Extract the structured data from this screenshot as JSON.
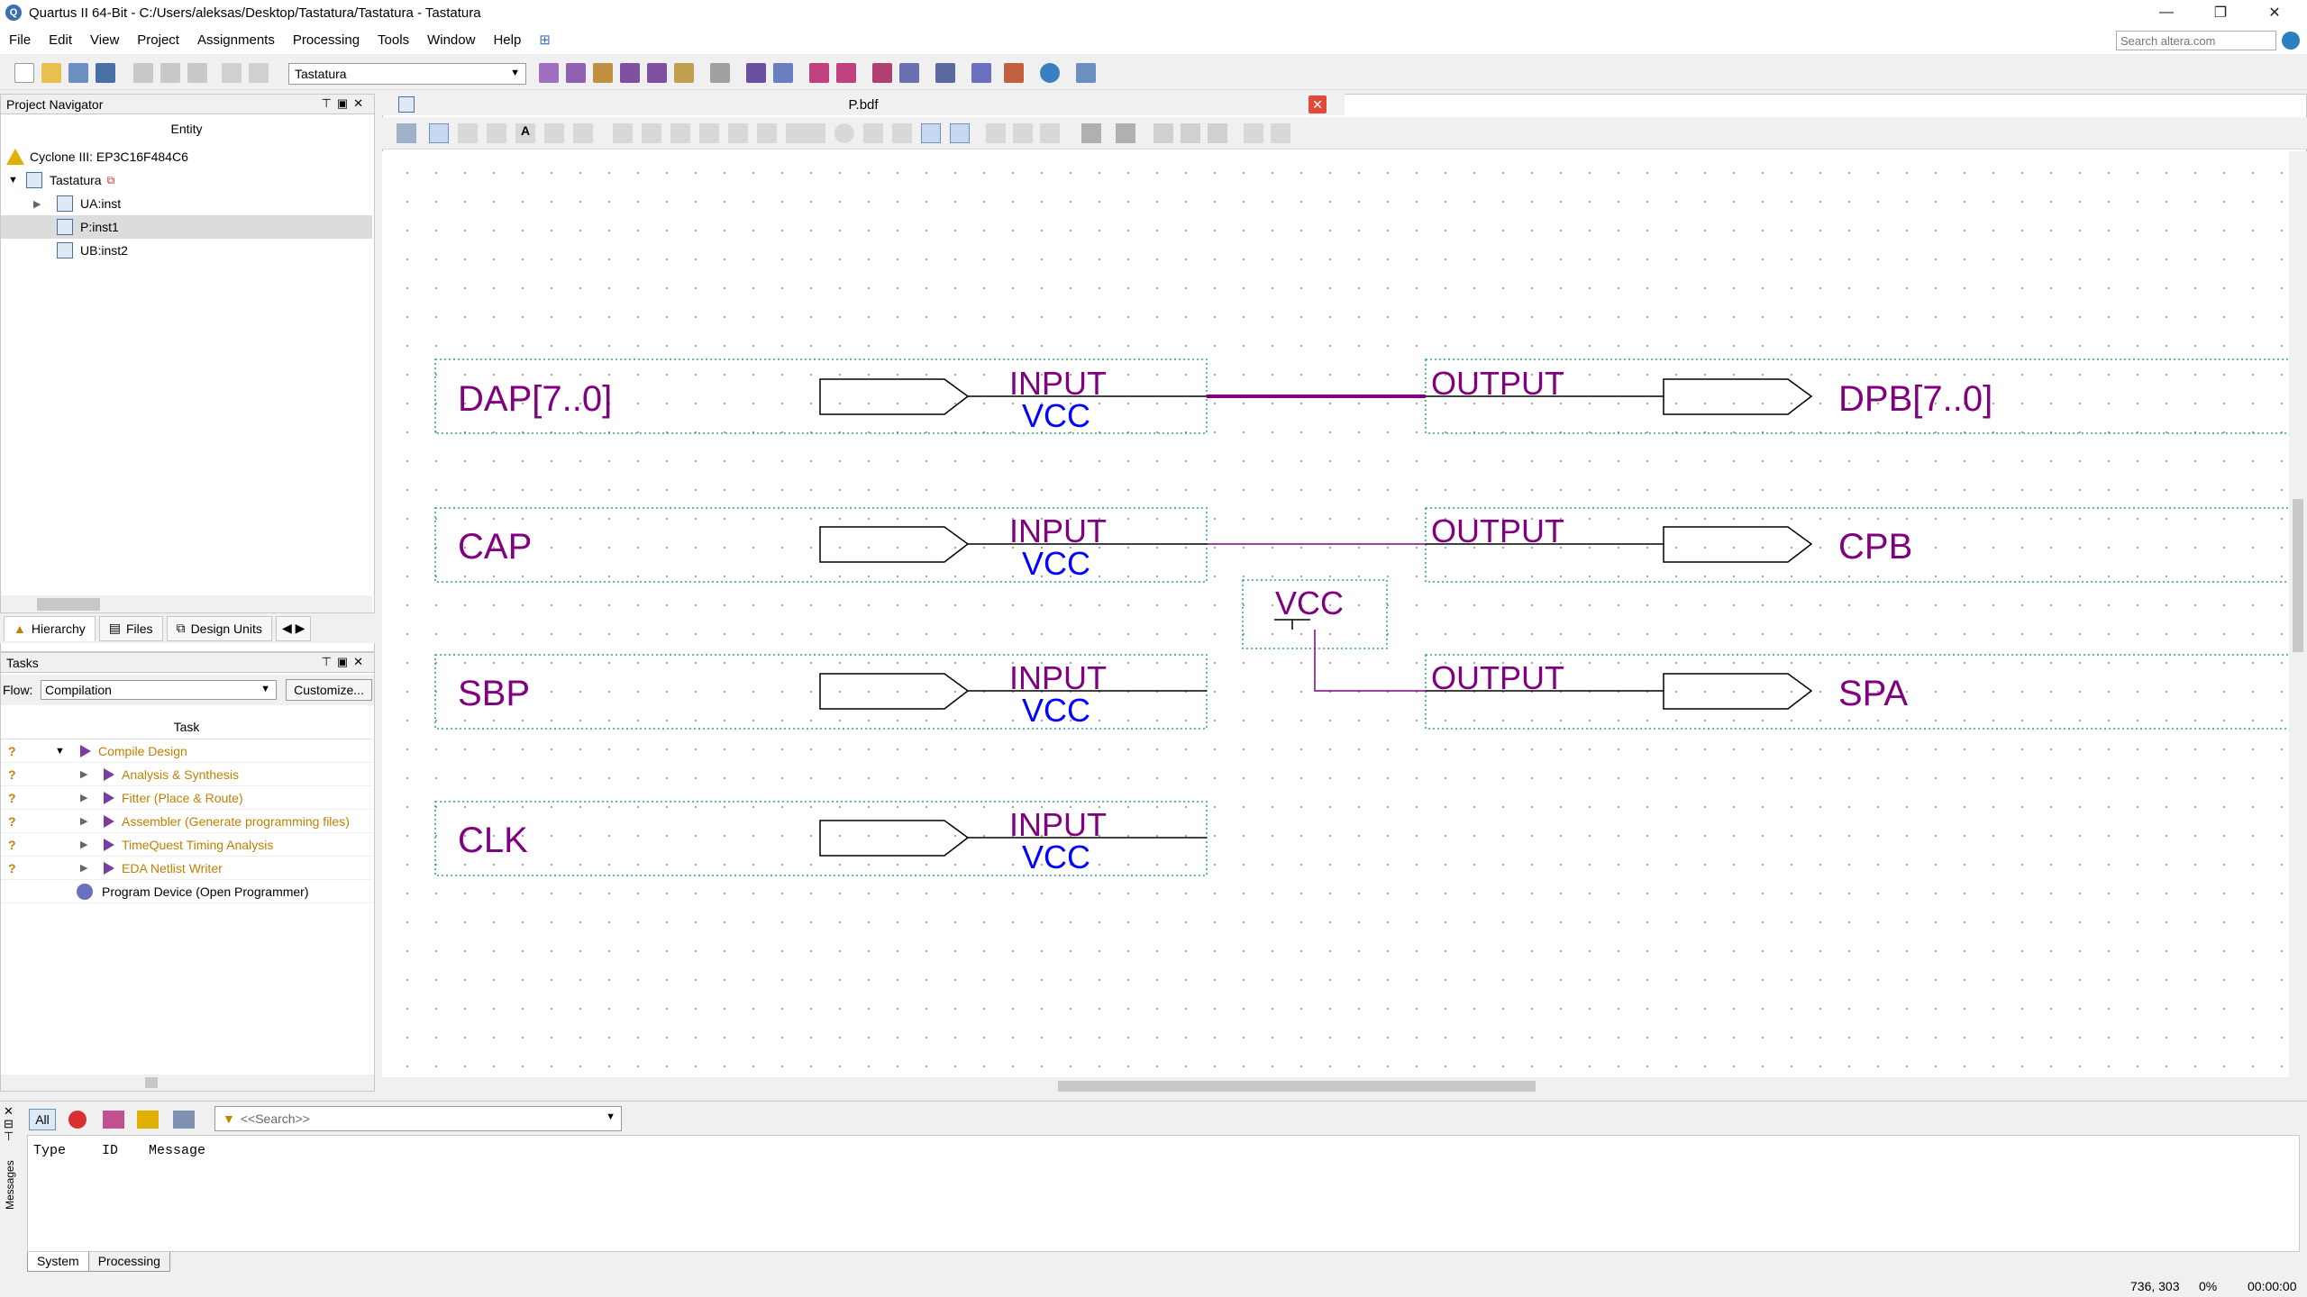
{
  "window": {
    "title": "Quartus II 64-Bit - C:/Users/aleksas/Desktop/Tastatura/Tastatura - Tastatura",
    "minimize": "—",
    "maximize": "❐",
    "close": "✕"
  },
  "menu": [
    "File",
    "Edit",
    "View",
    "Project",
    "Assignments",
    "Processing",
    "Tools",
    "Window",
    "Help"
  ],
  "search": {
    "placeholder": "Search altera.com"
  },
  "toolbar": {
    "project_select": "Tastatura"
  },
  "navigator": {
    "title": "Project Navigator",
    "column": "Entity",
    "device": "Cyclone III: EP3C16F484C6",
    "root": "Tastatura",
    "items": [
      {
        "label": "UA:inst",
        "selected": false
      },
      {
        "label": "P:inst1",
        "selected": true
      },
      {
        "label": "UB:inst2",
        "selected": false
      }
    ],
    "tabs": [
      "Hierarchy",
      "Files",
      "Design Units"
    ]
  },
  "tasks": {
    "title": "Tasks",
    "flow_label": "Flow:",
    "flow_value": "Compilation",
    "customize": "Customize...",
    "column": "Task",
    "items": [
      {
        "label": "Compile Design",
        "status": "?"
      },
      {
        "label": "Analysis & Synthesis",
        "status": "?"
      },
      {
        "label": "Fitter (Place & Route)",
        "status": "?"
      },
      {
        "label": "Assembler (Generate programming files)",
        "status": "?"
      },
      {
        "label": "TimeQuest Timing Analysis",
        "status": "?"
      },
      {
        "label": "EDA Netlist Writer",
        "status": "?"
      },
      {
        "label": "Program Device (Open Programmer)",
        "status": ""
      }
    ]
  },
  "document": {
    "tab": "P.bdf"
  },
  "schematic": {
    "pin_type_input": "INPUT",
    "pin_type_output": "OUTPUT",
    "pin_default": "VCC",
    "vcc_symbol": "VCC",
    "inputs": [
      "DAP[7..0]",
      "CAP",
      "SBP",
      "CLK"
    ],
    "outputs": [
      "DPB[7..0]",
      "CPB",
      "SPA"
    ],
    "colors": {
      "pin_name": "#800080",
      "default": "#0000ff",
      "wire": "#800080"
    }
  },
  "messages": {
    "filter_all": "All",
    "search_placeholder": "<<Search>>",
    "columns": [
      "Type",
      "ID",
      "Message"
    ],
    "tabs": [
      "System",
      "Processing"
    ],
    "side_label": "Messages"
  },
  "status": {
    "coords": "736, 303",
    "progress": "0%",
    "time": "00:00:00"
  }
}
